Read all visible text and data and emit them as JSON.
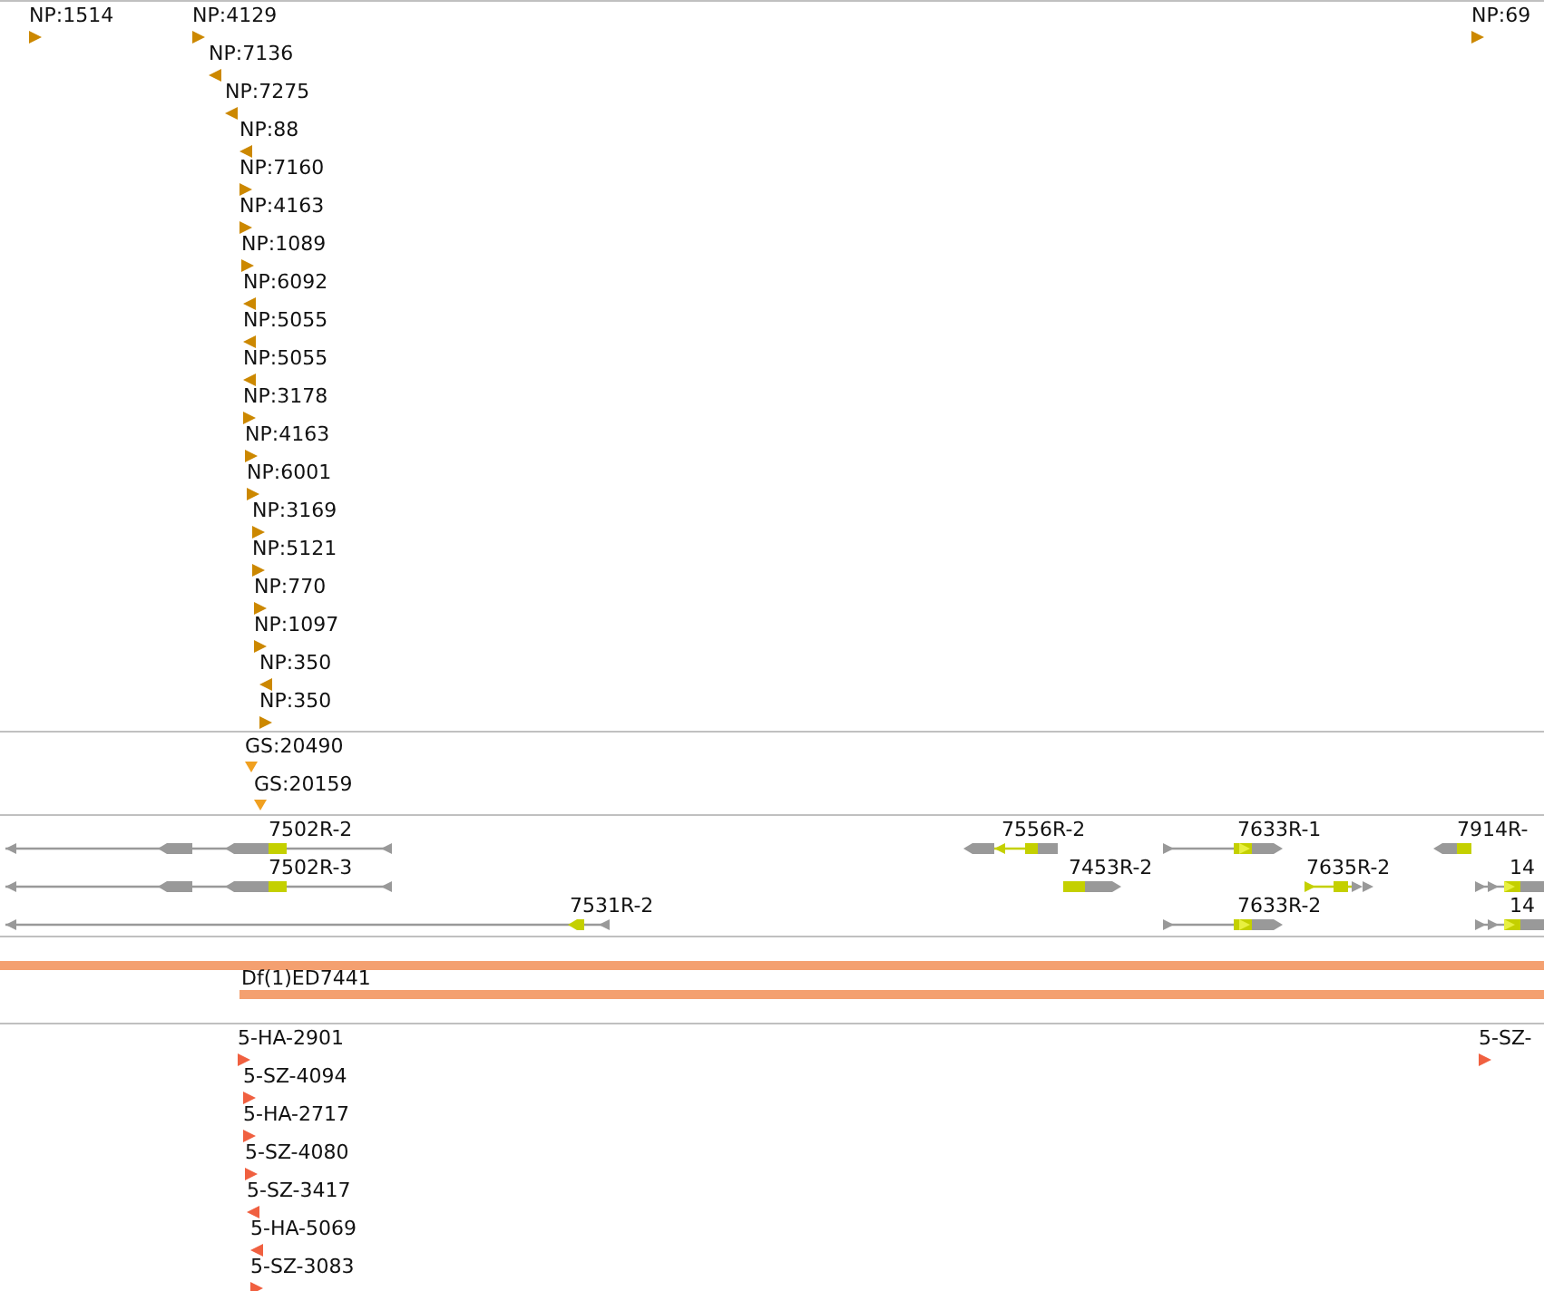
{
  "tracks": [
    {
      "kind": "insertions",
      "color": "#cc8800",
      "rows": [
        {
          "features": [
            {
              "label": "NP:1514",
              "kind": "forward"
            },
            {
              "label": "NP:4129",
              "kind": "forward"
            },
            {
              "label": "NP:69",
              "kind": "forward"
            }
          ]
        },
        {
          "features": [
            {
              "label": "NP:7136",
              "kind": "reverse"
            }
          ]
        },
        {
          "features": [
            {
              "label": "NP:7275",
              "kind": "reverse"
            }
          ]
        },
        {
          "features": [
            {
              "label": "NP:88",
              "kind": "reverse"
            }
          ]
        },
        {
          "features": [
            {
              "label": "NP:7160",
              "kind": "forward"
            }
          ]
        },
        {
          "features": [
            {
              "label": "NP:4163",
              "kind": "forward"
            }
          ]
        },
        {
          "features": [
            {
              "label": "NP:1089",
              "kind": "forward"
            }
          ]
        },
        {
          "features": [
            {
              "label": "NP:6092",
              "kind": "reverse"
            }
          ]
        },
        {
          "features": [
            {
              "label": "NP:5055",
              "kind": "reverse"
            }
          ]
        },
        {
          "features": [
            {
              "label": "NP:5055",
              "kind": "reverse"
            }
          ]
        },
        {
          "features": [
            {
              "label": "NP:3178",
              "kind": "forward"
            }
          ]
        },
        {
          "features": [
            {
              "label": "NP:4163",
              "kind": "forward"
            }
          ]
        },
        {
          "features": [
            {
              "label": "NP:6001",
              "kind": "forward"
            }
          ]
        },
        {
          "features": [
            {
              "label": "NP:3169",
              "kind": "forward"
            }
          ]
        },
        {
          "features": [
            {
              "label": "NP:5121",
              "kind": "forward"
            }
          ]
        },
        {
          "features": [
            {
              "label": "NP:770",
              "kind": "forward"
            }
          ]
        },
        {
          "features": [
            {
              "label": "NP:1097",
              "kind": "forward"
            }
          ]
        },
        {
          "features": [
            {
              "label": "NP:350",
              "kind": "reverse"
            }
          ]
        },
        {
          "features": [
            {
              "label": "NP:350",
              "kind": "forward"
            }
          ]
        }
      ]
    },
    {
      "kind": "insertions",
      "color": "#f0a020",
      "rows": [
        {
          "features": [
            {
              "label": "GS:20490",
              "kind": "unstranded"
            }
          ]
        },
        {
          "features": [
            {
              "label": "GS:20159",
              "kind": "unstranded"
            }
          ]
        }
      ]
    },
    {
      "kind": "genes",
      "rows": [
        {
          "features": [
            {
              "label": "7502R-2"
            },
            {
              "label": "7556R-2"
            },
            {
              "label": "7633R-1"
            },
            {
              "label": "7914R-"
            }
          ]
        },
        {
          "features": [
            {
              "label": "7502R-3"
            },
            {
              "label": "7453R-2"
            },
            {
              "label": "7635R-2"
            },
            {
              "label": "14"
            }
          ]
        },
        {
          "features": [
            {
              "label": "7531R-2"
            },
            {
              "label": "7633R-2"
            },
            {
              "label": "14"
            }
          ]
        }
      ]
    },
    {
      "kind": "deficiencies",
      "color": "#f4a070",
      "rows": [
        {
          "features": [
            {
              "kind": "deficiency"
            }
          ]
        },
        {
          "features": [
            {
              "label": "Df(1)ED7441",
              "kind": "deficiency"
            }
          ]
        }
      ]
    },
    {
      "kind": "insertions",
      "color": "#f06040",
      "rows": [
        {
          "features": [
            {
              "label": "5-HA-2901",
              "kind": "forward"
            },
            {
              "label": "5-SZ-",
              "kind": "forward"
            }
          ]
        },
        {
          "features": [
            {
              "label": "5-SZ-4094",
              "kind": "forward"
            }
          ]
        },
        {
          "features": [
            {
              "label": "5-HA-2717",
              "kind": "forward"
            }
          ]
        },
        {
          "features": [
            {
              "label": "5-SZ-4080",
              "kind": "forward"
            }
          ]
        },
        {
          "features": [
            {
              "label": "5-SZ-3417",
              "kind": "reverse"
            }
          ]
        },
        {
          "features": [
            {
              "label": "5-HA-5069",
              "kind": "reverse"
            }
          ]
        },
        {
          "features": [
            {
              "label": "5-SZ-3083",
              "kind": "forward"
            }
          ]
        }
      ]
    }
  ]
}
